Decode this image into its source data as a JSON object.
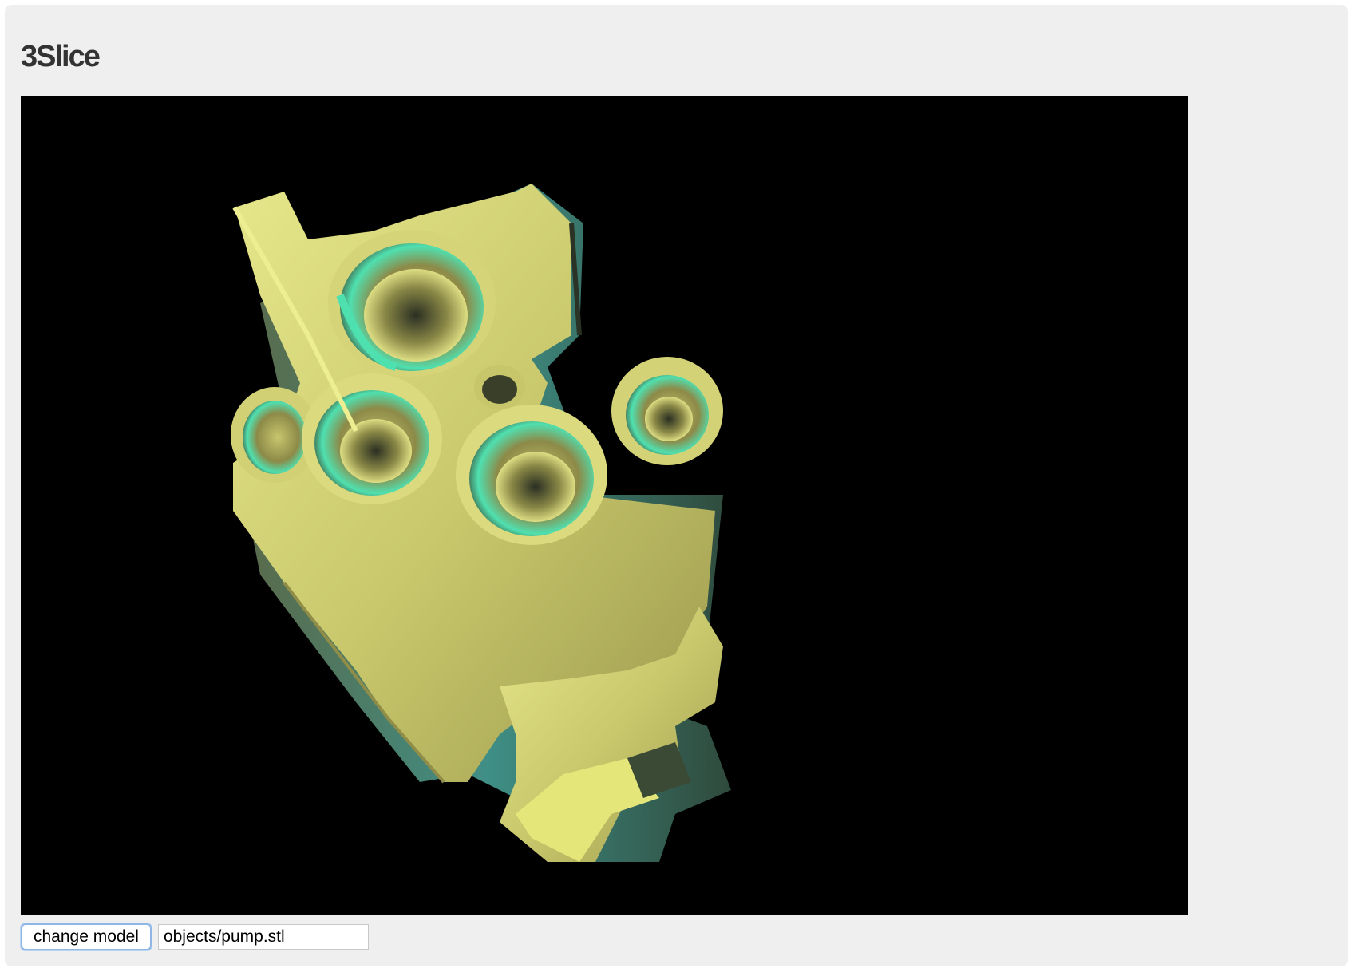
{
  "app": {
    "title": "3Slice"
  },
  "viewer": {
    "background_color": "#000000",
    "model_color": "#d8d878",
    "highlight_color": "#4fe0b0"
  },
  "controls": {
    "change_model_label": "change model",
    "model_path_value": "objects/pump.stl"
  }
}
